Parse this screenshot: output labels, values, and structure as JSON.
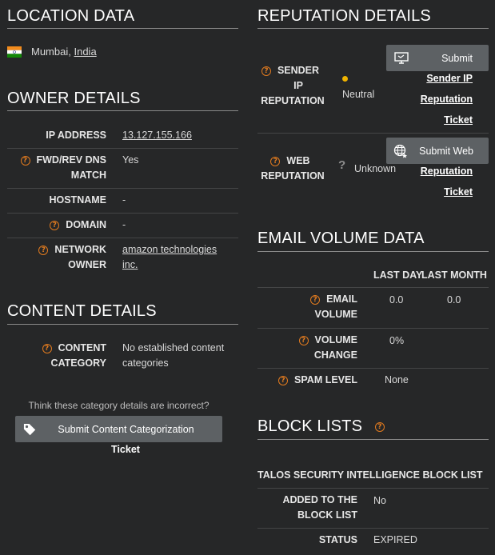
{
  "location": {
    "title": "LOCATION DATA",
    "city": "Mumbai,",
    "country": "India"
  },
  "owner": {
    "title": "OWNER DETAILS",
    "ip_label": "IP ADDRESS",
    "ip_value": "13.127.155.166",
    "fwd_label_1": "FWD/REV DNS",
    "fwd_label_2": "MATCH",
    "fwd_value": "Yes",
    "hostname_label": "HOSTNAME",
    "hostname_value": "-",
    "domain_label": "DOMAIN",
    "domain_value": "-",
    "network_label_1": "NETWORK",
    "network_label_2": "OWNER",
    "network_value_1": "amazon technologies",
    "network_value_2": "inc."
  },
  "content": {
    "title": "CONTENT DETAILS",
    "category_label_1": "CONTENT",
    "category_label_2": "CATEGORY",
    "category_value_1": "No established content",
    "category_value_2": "categories",
    "prompt": "Think these category details are incorrect?",
    "submit_label": "Submit Content Categorization",
    "ticket_label": "Ticket"
  },
  "reputation": {
    "title": "REPUTATION DETAILS",
    "sender_label_1": "SENDER",
    "sender_label_2": "IP",
    "sender_label_3": "REPUTATION",
    "sender_value": "Neutral",
    "sender_btn": "Submit",
    "sender_link_1": "Sender IP",
    "sender_link_2": "Reputation",
    "sender_link_3": "Ticket",
    "web_label_1": "WEB",
    "web_label_2": "REPUTATION",
    "web_value": "Unknown",
    "web_btn": "Submit Web",
    "web_link_1": "Reputation",
    "web_link_2": "Ticket",
    "neutral_color": "#f0b400"
  },
  "email": {
    "title": "EMAIL VOLUME DATA",
    "col_day": "LAST DAY",
    "col_month": "LAST MONTH",
    "volume_label_1": "EMAIL",
    "volume_label_2": "VOLUME",
    "volume_day": "0.0",
    "volume_month": "0.0",
    "change_label_1": "VOLUME",
    "change_label_2": "CHANGE",
    "change_day": "0%",
    "spam_label": "SPAM LEVEL",
    "spam_value": "None"
  },
  "block": {
    "title": "BLOCK LISTS",
    "list_name": "TALOS SECURITY INTELLIGENCE BLOCK LIST",
    "added_label_1": "ADDED TO THE",
    "added_label_2": "BLOCK LIST",
    "added_value": "No",
    "status_label": "STATUS",
    "status_value": "EXPIRED"
  },
  "accent_color": "#e07a1f"
}
